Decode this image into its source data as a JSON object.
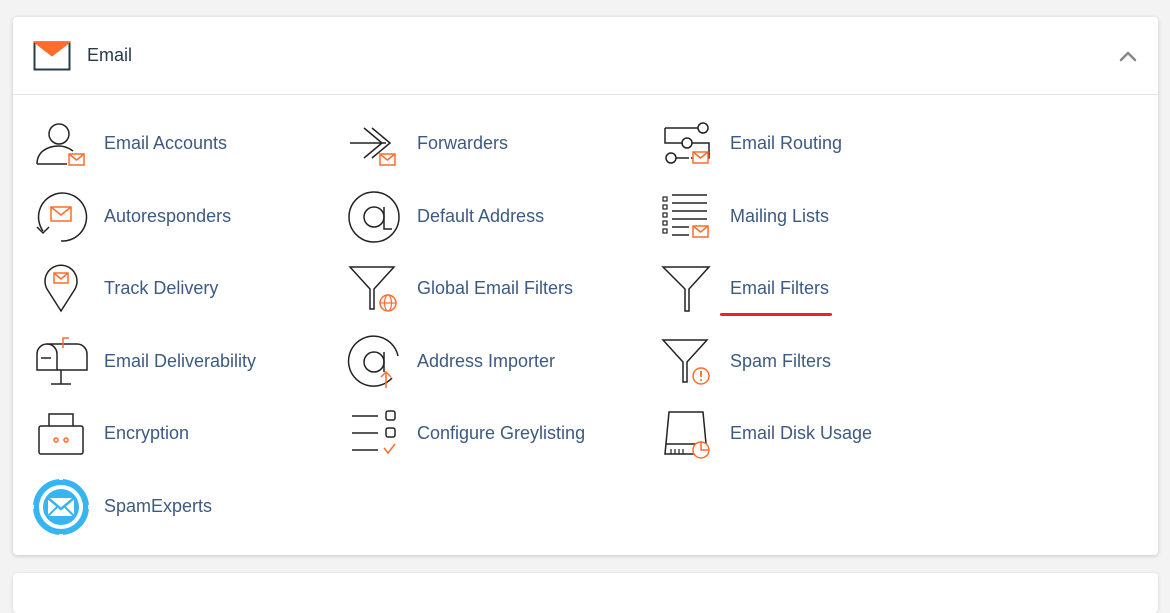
{
  "colors": {
    "accent": "#ff6c2c",
    "link": "#3d5a80",
    "header_text": "#293a4a",
    "underline": "#e8232a",
    "spamexperts_blue": "#36b5f2"
  },
  "panel": {
    "title": "Email",
    "title_icon": "envelope-icon",
    "collapse_icon": "chevron-up-icon"
  },
  "items": [
    {
      "label": "Email Accounts",
      "icon": "user-mail-icon"
    },
    {
      "label": "Forwarders",
      "icon": "forward-arrow-icon"
    },
    {
      "label": "Email Routing",
      "icon": "routing-icon"
    },
    {
      "label": "Autoresponders",
      "icon": "autoresponder-icon"
    },
    {
      "label": "Default Address",
      "icon": "at-sign-icon"
    },
    {
      "label": "Mailing Lists",
      "icon": "mailing-list-icon"
    },
    {
      "label": "Track Delivery",
      "icon": "location-pin-icon"
    },
    {
      "label": "Global Email Filters",
      "icon": "funnel-globe-icon"
    },
    {
      "label": "Email Filters",
      "icon": "funnel-icon"
    },
    {
      "label": "Email Deliverability",
      "icon": "mailbox-icon"
    },
    {
      "label": "Address Importer",
      "icon": "at-import-icon"
    },
    {
      "label": "Spam Filters",
      "icon": "funnel-warning-icon"
    },
    {
      "label": "Encryption",
      "icon": "lock-icon"
    },
    {
      "label": "Configure Greylisting",
      "icon": "checklist-icon"
    },
    {
      "label": "Email Disk Usage",
      "icon": "disk-usage-icon"
    },
    {
      "label": "SpamExperts",
      "icon": "spamexperts-icon"
    }
  ]
}
